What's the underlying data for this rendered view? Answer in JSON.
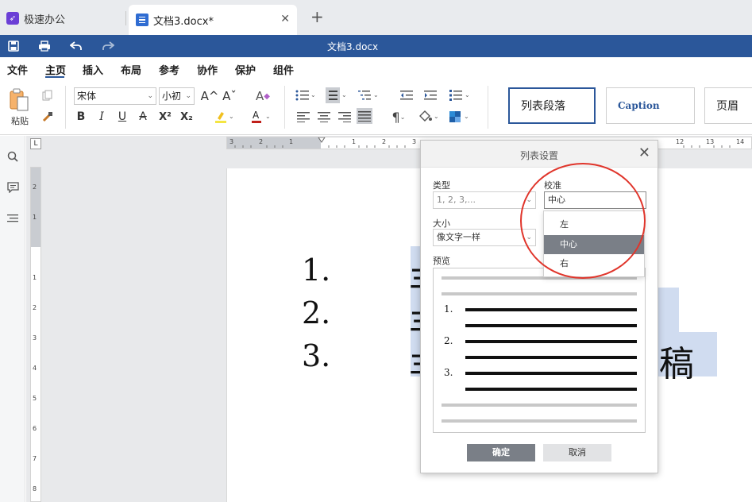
{
  "tabs": {
    "app_label": "极速办公",
    "doc_label": "文档3.docx*",
    "close_glyph": "✕",
    "new_glyph": "+"
  },
  "titlebar": {
    "title": "文档3.docx"
  },
  "menu": [
    "文件",
    "主页",
    "插入",
    "布局",
    "参考",
    "协作",
    "保护",
    "组件"
  ],
  "ribbon": {
    "paste_label": "粘贴",
    "font_name": "宋体",
    "font_size": "小初",
    "bold": "B",
    "italic": "I",
    "underline": "U",
    "strike": "A",
    "superscript": "X²",
    "subscript": "X₂",
    "grow": "A^",
    "shrink": "Aˇ",
    "styles": [
      "列表段落",
      "Caption",
      "页眉"
    ]
  },
  "ruler": {
    "h_ticks": [
      "3",
      "2",
      "1",
      "1",
      "2",
      "3",
      "12",
      "13",
      "14"
    ],
    "v_ticks": [
      "2",
      "1",
      "1",
      "2",
      "3",
      "4",
      "5",
      "6",
      "7",
      "8"
    ]
  },
  "document": {
    "numbers": [
      "1.",
      "2.",
      "3."
    ],
    "visible_glyph": "稿",
    "partial_glyph": "丰"
  },
  "dialog": {
    "title": "列表设置",
    "type_label": "类型",
    "type_value": "1, 2, 3,...",
    "align_label": "校准",
    "align_value": "中心",
    "size_label": "大小",
    "size_value": "像文字一样",
    "preview_label": "预览",
    "preview_numbers": [
      "1.",
      "2.",
      "3."
    ],
    "ok_label": "确定",
    "cancel_label": "取消",
    "align_options": [
      "左",
      "中心",
      "右"
    ],
    "selected_option": "中心"
  },
  "colors": {
    "accent": "#2b579a",
    "highlight": "#d0dcf0",
    "annotation_ring": "#e0352b",
    "selected_option_bg": "#7a7f87"
  }
}
